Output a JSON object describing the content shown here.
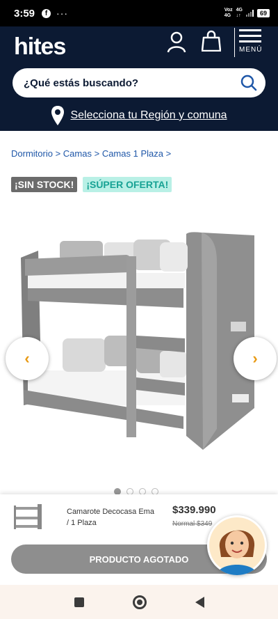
{
  "status_bar": {
    "time": "3:59",
    "facebook_glyph": "f",
    "more_dots": "···",
    "network_1_line1": "Voz",
    "network_1_line2": "4G",
    "network_2": "4G",
    "battery": "69"
  },
  "header": {
    "logo": "hites",
    "menu_label": "MENÚ",
    "search_placeholder": "¿Qué estás buscando?",
    "region_link": "Selecciona tu Región y comuna"
  },
  "breadcrumb": [
    "Dormitorio",
    "Camas",
    "Camas 1 Plaza"
  ],
  "breadcrumb_separator": " > ",
  "badges": {
    "stock": "¡SIN STOCK!",
    "offer": "¡SÚPER OFERTA!"
  },
  "carousel": {
    "prev_glyph": "‹",
    "next_glyph": "›",
    "image_count": 4,
    "active_index": 0
  },
  "sticky_bar": {
    "product_name": "Camarote Decocasa Ema / 1 Plaza",
    "price": "$339.990",
    "normal_price": "Normal $349",
    "cta": "PRODUCTO AGOTADO"
  },
  "colors": {
    "header_bg": "#0c1a33",
    "accent_orange": "#e89a14",
    "offer_bg": "#b9f0e6",
    "offer_text": "#17a294",
    "link_blue": "#1f57a8"
  }
}
